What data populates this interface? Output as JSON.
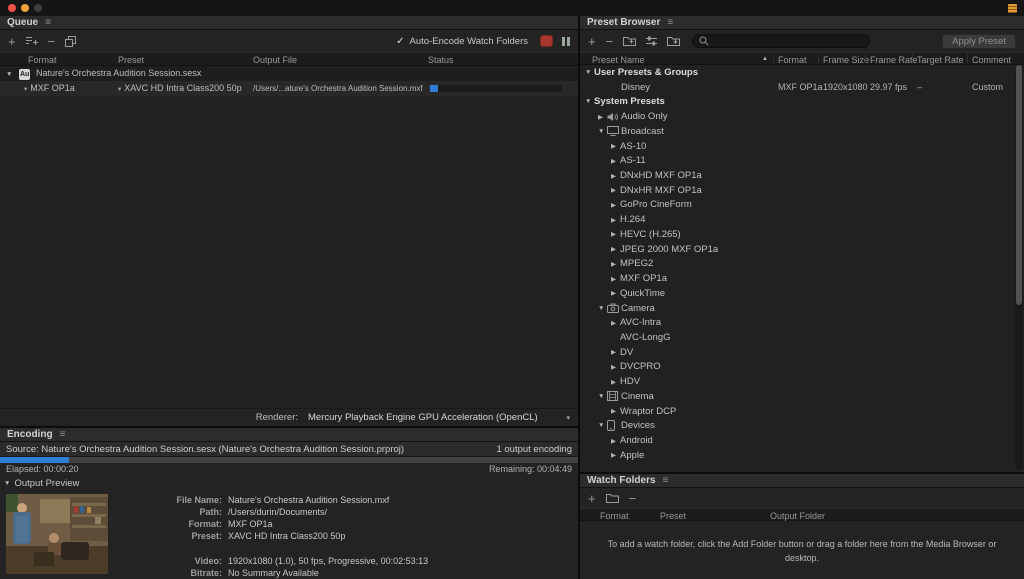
{
  "window": {
    "controls": [
      "close",
      "minimize",
      "zoom"
    ]
  },
  "queue": {
    "title": "Queue",
    "toolbar": {
      "icons": [
        "add-source",
        "add-output",
        "remove",
        "duplicate"
      ],
      "auto_encode_label": "Auto-Encode Watch Folders",
      "auto_encode_checked": true
    },
    "columns": [
      "Format",
      "Preset",
      "Output File",
      "Status"
    ],
    "source_row": {
      "badge": "Au",
      "name": "Nature's Orchestra Audition Session.sesx"
    },
    "output_row": {
      "format": "MXF OP1a",
      "preset": "XAVC HD Intra Class200 50p",
      "output_file": "/Users/...ature's Orchestra Audition Session.mxf",
      "progress_percent": 6
    },
    "renderer": {
      "label": "Renderer:",
      "value": "Mercury Playback Engine GPU Acceleration (OpenCL)"
    }
  },
  "preset_browser": {
    "title": "Preset Browser",
    "toolbar": {
      "icons": [
        "create-preset",
        "delete-preset",
        "create-group",
        "preset-settings",
        "import-preset"
      ],
      "search_value": "",
      "apply_button_label": "Apply Preset"
    },
    "columns": [
      "Preset Name",
      "Format",
      "Frame Size",
      "Frame Rate",
      "Target Rate",
      "Comment"
    ],
    "sort_column": "Preset Name",
    "sort_direction": "ascending",
    "tree": [
      {
        "label": "User Presets & Groups",
        "level": 0,
        "state": "expanded",
        "group": true
      },
      {
        "label": "Disney",
        "level": 1,
        "spacer": true,
        "cells": [
          "MXF OP1a",
          "1920x1080",
          "29.97 fps",
          "–",
          "Custom"
        ]
      },
      {
        "label": "System Presets",
        "level": 0,
        "state": "expanded",
        "group": true
      },
      {
        "label": "Audio Only",
        "level": 1,
        "state": "collapsed",
        "icon": "speaker"
      },
      {
        "label": "Broadcast",
        "level": 1,
        "state": "expanded",
        "icon": "tv"
      },
      {
        "label": "AS-10",
        "level": 2,
        "state": "collapsed"
      },
      {
        "label": "AS-11",
        "level": 2,
        "state": "collapsed"
      },
      {
        "label": "DNxHD MXF OP1a",
        "level": 2,
        "state": "collapsed"
      },
      {
        "label": "DNxHR MXF OP1a",
        "level": 2,
        "state": "collapsed"
      },
      {
        "label": "GoPro CineForm",
        "level": 2,
        "state": "collapsed"
      },
      {
        "label": "H.264",
        "level": 2,
        "state": "collapsed"
      },
      {
        "label": "HEVC (H.265)",
        "level": 2,
        "state": "collapsed"
      },
      {
        "label": "JPEG 2000 MXF OP1a",
        "level": 2,
        "state": "collapsed"
      },
      {
        "label": "MPEG2",
        "level": 2,
        "state": "collapsed"
      },
      {
        "label": "MXF OP1a",
        "level": 2,
        "state": "collapsed"
      },
      {
        "label": "QuickTime",
        "level": 2,
        "state": "collapsed"
      },
      {
        "label": "Camera",
        "level": 1,
        "state": "expanded",
        "icon": "camera"
      },
      {
        "label": "AVC-Intra",
        "level": 2,
        "state": "collapsed"
      },
      {
        "label": "AVC-LongG",
        "level": 2
      },
      {
        "label": "DV",
        "level": 2,
        "state": "collapsed"
      },
      {
        "label": "DVCPRO",
        "level": 2,
        "state": "collapsed"
      },
      {
        "label": "HDV",
        "level": 2,
        "state": "collapsed"
      },
      {
        "label": "Cinema",
        "level": 1,
        "state": "expanded",
        "icon": "film"
      },
      {
        "label": "Wraptor DCP",
        "level": 2,
        "state": "collapsed"
      },
      {
        "label": "Devices",
        "level": 1,
        "state": "expanded",
        "icon": "device"
      },
      {
        "label": "Android",
        "level": 2,
        "state": "collapsed"
      },
      {
        "label": "Apple",
        "level": 2,
        "state": "collapsed"
      }
    ]
  },
  "encoding": {
    "title": "Encoding",
    "source_label": "Source: Nature's Orchestra Audition Session.sesx (Nature's Orchestra Audition Session.prproj)",
    "status_right": "1 output encoding",
    "progress_percent": 12,
    "elapsed": "Elapsed: 00:00:20",
    "remaining": "Remaining: 00:04:49",
    "preview_label": "Output Preview",
    "details": [
      {
        "label": "File Name:",
        "value": "Nature's Orchestra Audition Session.mxf"
      },
      {
        "label": "Path:",
        "value": "/Users/durin/Documents/"
      },
      {
        "label": "Format:",
        "value": "MXF OP1a"
      },
      {
        "label": "Preset:",
        "value": "XAVC HD Intra Class200 50p"
      },
      {
        "label": "Video:",
        "value": "1920x1080 (1.0), 50 fps, Progressive, 00:02:53:13",
        "gap_before": true
      },
      {
        "label": "Bitrate:",
        "value": "No Summary Available"
      }
    ]
  },
  "watch_folders": {
    "title": "Watch Folders",
    "toolbar": {
      "icons": [
        "add-folder",
        "folder",
        "remove-folder"
      ]
    },
    "columns": [
      "Format",
      "Preset",
      "Output Folder"
    ],
    "empty_message": "To add a watch folder, click the Add Folder button or drag a folder here from the Media Browser or desktop."
  }
}
